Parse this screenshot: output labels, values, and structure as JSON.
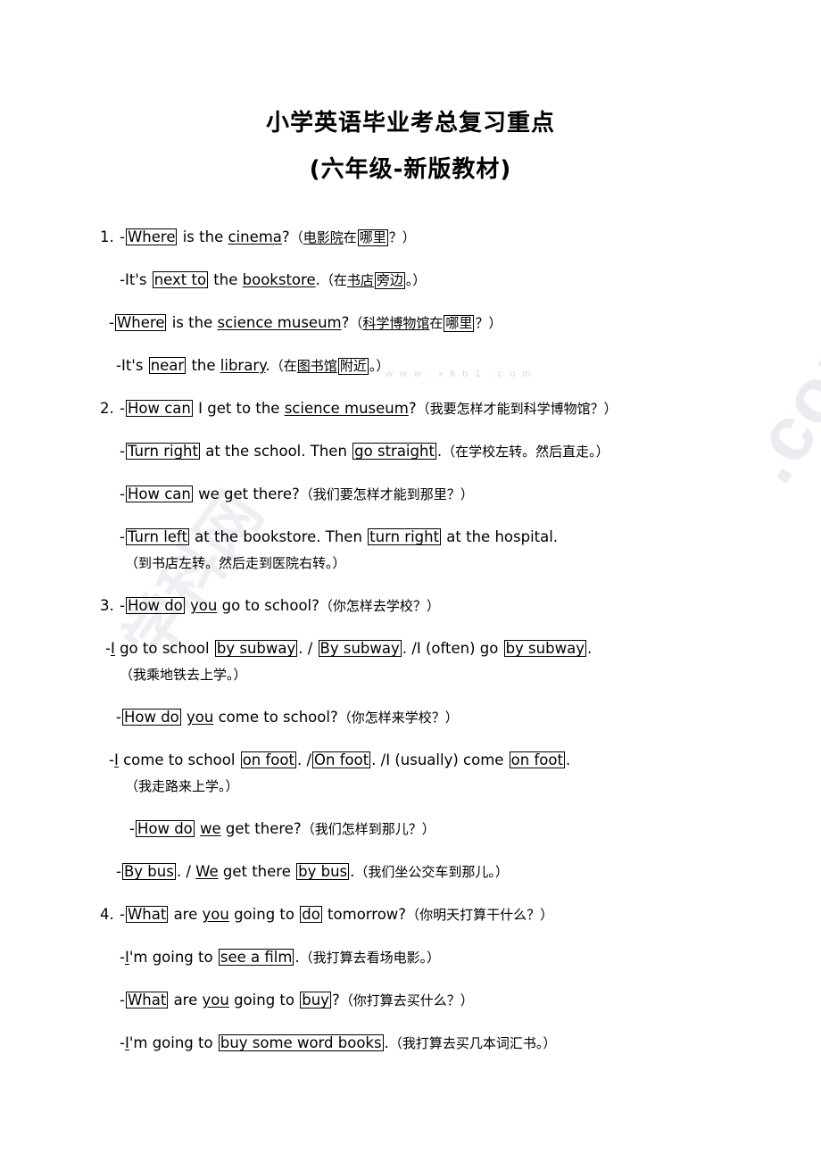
{
  "document": {
    "title_line_1": "小学英语毕业考总复习重点",
    "title_line_2": "(六年级-新版教材)"
  },
  "watermark": {
    "right_text": ".com",
    "left_text": "学科网",
    "tiny_text": "w w w . x k b 1 . c o m"
  },
  "sections": [
    {
      "number": "1.",
      "lines": [
        {
          "id": "1a",
          "dash": "-",
          "box1": "Where",
          "mid1": " is the ",
          "ul1": "cinema",
          "tail1": "?",
          "cn_open": "（",
          "cn_a": "电影院",
          "cn_b": "在",
          "cn_box": "哪里",
          "cn_close": "？）"
        },
        {
          "id": "1b",
          "dash": "-",
          "pre": "It's ",
          "box1": "next to",
          "mid1": " the ",
          "ul1": "bookstore",
          "tail1": ".",
          "cn_open": "（",
          "cn_a": "在",
          "cn_b": "书店",
          "cn_box": "旁边",
          "cn_close": "。）"
        },
        {
          "id": "1c",
          "dash": "-",
          "box1": "Where",
          "mid1": " is the ",
          "ul1": "science museum",
          "tail1": "?",
          "cn_open": "（",
          "cn_a": "科学博物馆",
          "cn_b": "在",
          "cn_box": "哪里",
          "cn_close": "？）"
        },
        {
          "id": "1d",
          "dash": "-",
          "pre": "It's ",
          "box1": "near",
          "mid1": " the ",
          "ul1": "library",
          "tail1": ".",
          "cn_open": "（",
          "cn_a": "在",
          "cn_b": "图书馆",
          "cn_box": "附近",
          "cn_close": "。）"
        }
      ]
    },
    {
      "number": "2.",
      "lines": [
        {
          "id": "2a",
          "dash": "-",
          "box1": "How can",
          "mid1": " I get to the ",
          "ul1": "science museum",
          "tail1": "?",
          "cn": "（我要怎样才能到科学博物馆？）"
        },
        {
          "id": "2b",
          "dash": "-",
          "box1": "Turn right",
          "mid1": " at the school. Then ",
          "box2": "go straight",
          "tail1": ".",
          "cn": "（在学校左转。然后直走。）"
        },
        {
          "id": "2c",
          "dash": "-",
          "box1": "How can",
          "mid1": " we get there?",
          "cn": "（我们要怎样才能到那里？）"
        },
        {
          "id": "2d",
          "dash": "-",
          "box1": "Turn left",
          "mid1": " at the bookstore. Then ",
          "box2": "turn right",
          "tail1": " at the hospital."
        },
        {
          "id": "2e",
          "cn_only": "（到书店左转。然后走到医院右转。）"
        }
      ]
    },
    {
      "number": "3.",
      "lines": [
        {
          "id": "3a",
          "dash": "-",
          "box1": "How do",
          "mid1": " ",
          "ul1": "you",
          "tail1": " go to school?",
          "cn": "（你怎样去学校？）"
        },
        {
          "id": "3b",
          "dash": "-",
          "ul_lead": "I",
          "mid0": " go to school ",
          "box1": "by subway",
          "mid1": ". / ",
          "box2": "By subway",
          "mid2": ". /I (often) go ",
          "box3": "by subway",
          "tail1": "."
        },
        {
          "id": "3c",
          "cn_only": "（我乘地铁去上学。）"
        },
        {
          "id": "3d",
          "dash": "-",
          "box1": "How do",
          "mid1": " ",
          "ul1": "you",
          "tail1": " come to school?",
          "cn": "（你怎样来学校？）"
        },
        {
          "id": "3e",
          "dash": "-",
          "ul_lead": "I",
          "mid0": " come to school ",
          "box1": "on foot",
          "mid1": ". /",
          "box2": "On foot",
          "mid2": ". /I (usually) come ",
          "box3": "on foot",
          "tail1": "."
        },
        {
          "id": "3f",
          "cn_only": "（我走路来上学。）"
        },
        {
          "id": "3g",
          "dash": "-",
          "box1": "How do",
          "mid1": " ",
          "ul1": "we",
          "tail1": " get there?",
          "cn": "（我们怎样到那儿？）"
        },
        {
          "id": "3h",
          "dash": "-",
          "box1": "By bus",
          "mid1": ". / ",
          "ul1": "We",
          "mid2": " get there ",
          "box2": "by bus",
          "tail1": ".",
          "cn": "（我们坐公交车到那儿。）"
        }
      ]
    },
    {
      "number": "4.",
      "lines": [
        {
          "id": "4a",
          "dash": "-",
          "box1": "What",
          "mid1": " are ",
          "ul1": "you",
          "mid2": " going to ",
          "box2": "do",
          "tail1": " tomorrow?",
          "cn": "（你明天打算干什么？）"
        },
        {
          "id": "4b",
          "dash": "-",
          "ul_lead": "I",
          "mid0": "'m going to ",
          "box1": "see a film",
          "tail1": ".",
          "cn": "（我打算去看场电影。）"
        },
        {
          "id": "4c",
          "dash": "-",
          "box1": "What",
          "mid1": " are ",
          "ul1": "you",
          "mid2": " going to ",
          "box2": "buy",
          "tail1": "?",
          "cn": "（你打算去买什么？）"
        },
        {
          "id": "4d",
          "dash": "-",
          "ul_lead": "I",
          "mid0": "'m going to ",
          "box1": "buy some word books",
          "tail1": ".",
          "cn": "（我打算去买几本词汇书。）"
        }
      ]
    }
  ]
}
